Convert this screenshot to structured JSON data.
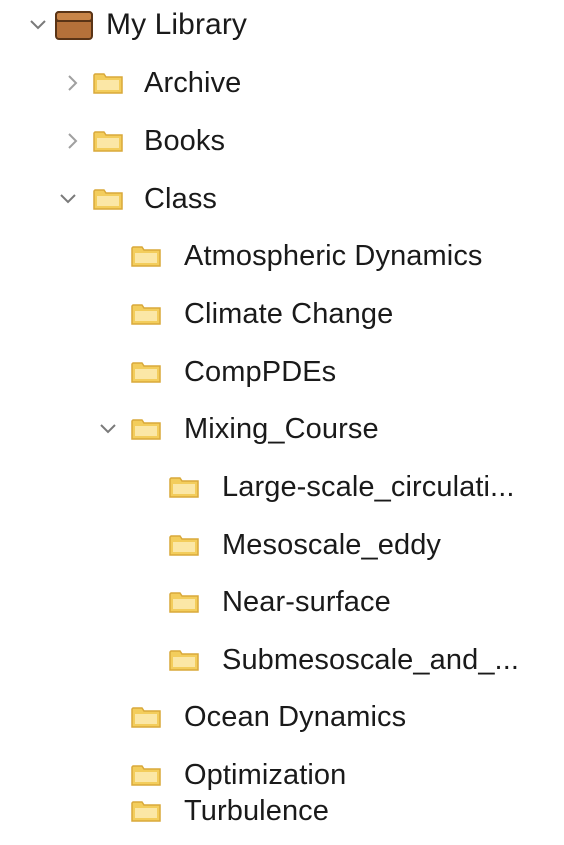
{
  "tree": {
    "root": {
      "label": "My Library",
      "icon": "library-box-icon",
      "expanded": true
    },
    "items": [
      {
        "label": "Archive",
        "icon": "folder-icon",
        "expanded": false
      },
      {
        "label": "Books",
        "icon": "folder-icon",
        "expanded": false
      },
      {
        "label": "Class",
        "icon": "folder-icon",
        "expanded": true
      },
      {
        "label": "Atmospheric Dynamics",
        "icon": "folder-icon"
      },
      {
        "label": "Climate Change",
        "icon": "folder-icon"
      },
      {
        "label": "CompPDEs",
        "icon": "folder-icon"
      },
      {
        "label": "Mixing_Course",
        "icon": "folder-icon",
        "expanded": true
      },
      {
        "label": "Large-scale_circulati...",
        "icon": "folder-icon"
      },
      {
        "label": "Mesoscale_eddy",
        "icon": "folder-icon"
      },
      {
        "label": "Near-surface",
        "icon": "folder-icon"
      },
      {
        "label": "Submesoscale_and_...",
        "icon": "folder-icon"
      },
      {
        "label": "Ocean Dynamics",
        "icon": "folder-icon"
      },
      {
        "label": "Optimization",
        "icon": "folder-icon"
      },
      {
        "label": "Turbulence",
        "icon": "folder-icon"
      }
    ]
  },
  "colors": {
    "folder_fill": "#f3cd5c",
    "folder_dark": "#d9a93a",
    "folder_light": "#fbe7a6",
    "library_fill": "#b5713a",
    "library_dark": "#7a4a22",
    "chevron": "#7a7a7a",
    "text": "#1a1a1a"
  }
}
